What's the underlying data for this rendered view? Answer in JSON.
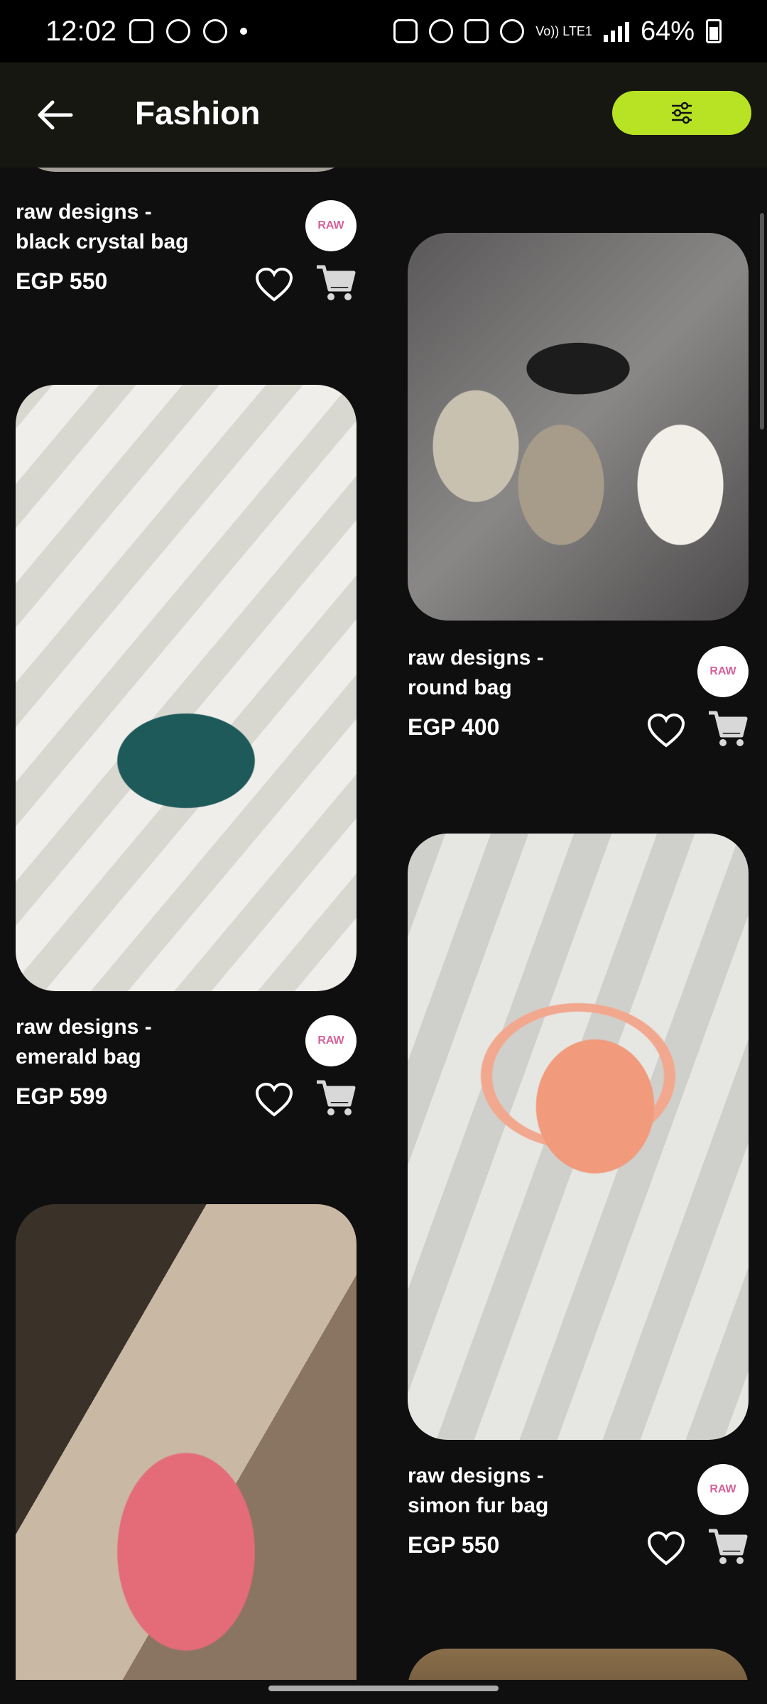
{
  "status": {
    "time": "12:02",
    "battery": "64%",
    "network": "Vo)) LTE1"
  },
  "appbar": {
    "title": "Fashion"
  },
  "colors": {
    "accent": "#b7e324",
    "background": "#0f0f0f"
  },
  "products": [
    {
      "name": "raw designs  -\nblack crystal bag",
      "price": "EGP 550"
    },
    {
      "name": "raw designs  -\nemerald bag",
      "price": "EGP 599"
    },
    {
      "name": "raw designs  -\nround bag",
      "price": "EGP 400"
    },
    {
      "name": "raw designs  -\nsimon fur bag",
      "price": "EGP 550"
    }
  ],
  "brand_logo_text": "RAW"
}
